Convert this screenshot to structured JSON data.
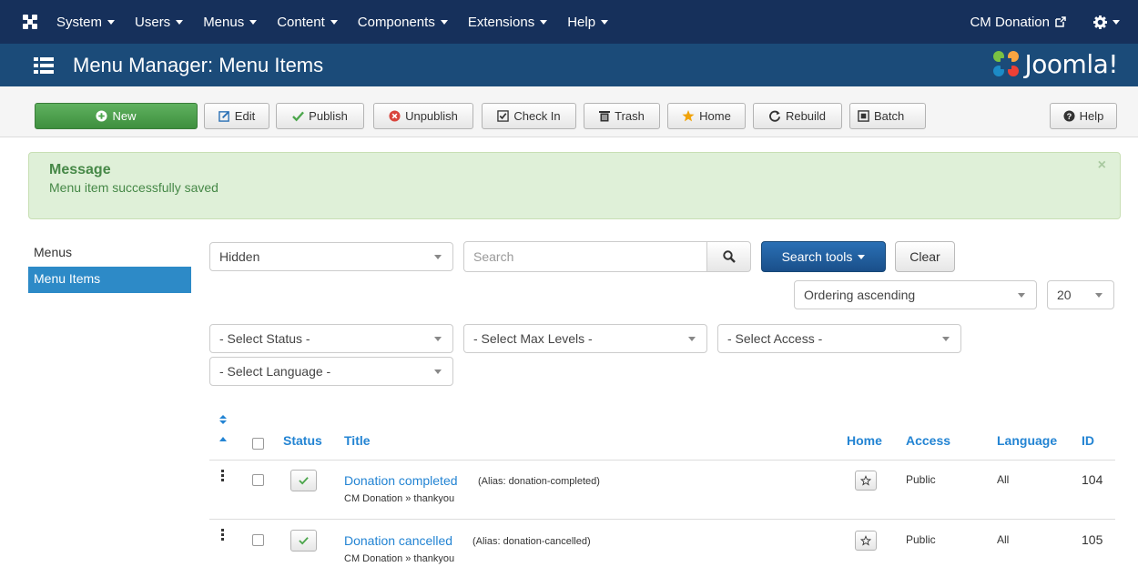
{
  "topbar": {
    "nav": [
      "System",
      "Users",
      "Menus",
      "Content",
      "Components",
      "Extensions",
      "Help"
    ],
    "site_link": "CM Donation"
  },
  "header": {
    "title": "Menu Manager: Menu Items",
    "brand": "Joomla!"
  },
  "toolbar": {
    "new": "New",
    "edit": "Edit",
    "publish": "Publish",
    "unpublish": "Unpublish",
    "check_in": "Check In",
    "trash": "Trash",
    "home": "Home",
    "rebuild": "Rebuild",
    "batch": "Batch",
    "help": "Help"
  },
  "message": {
    "heading": "Message",
    "text": "Menu item successfully saved"
  },
  "sidebar": {
    "items": [
      {
        "label": "Menus",
        "active": false
      },
      {
        "label": "Menu Items",
        "active": true
      }
    ]
  },
  "filters": {
    "menu_select": "Hidden",
    "search_placeholder": "Search",
    "search_tools": "Search tools",
    "clear": "Clear",
    "ordering": "Ordering ascending",
    "limit": "20",
    "status": "- Select Status -",
    "max_levels": "- Select Max Levels -",
    "access": "- Select Access -",
    "language": "- Select Language -"
  },
  "table": {
    "headers": {
      "status": "Status",
      "title": "Title",
      "home": "Home",
      "access": "Access",
      "language": "Language",
      "id": "ID"
    },
    "rows": [
      {
        "title": "Donation completed",
        "alias": "(Alias: donation-completed)",
        "path": "CM Donation » thankyou",
        "access": "Public",
        "language": "All",
        "id": "104"
      },
      {
        "title": "Donation cancelled",
        "alias": "(Alias: donation-cancelled)",
        "path": "CM Donation » thankyou",
        "access": "Public",
        "language": "All",
        "id": "105"
      }
    ]
  },
  "colors": {
    "topbar": "#16305b",
    "header": "#1b4b79",
    "link": "#2384d3",
    "success_bg": "#dff0d8",
    "new_button": "#4ca64c"
  }
}
